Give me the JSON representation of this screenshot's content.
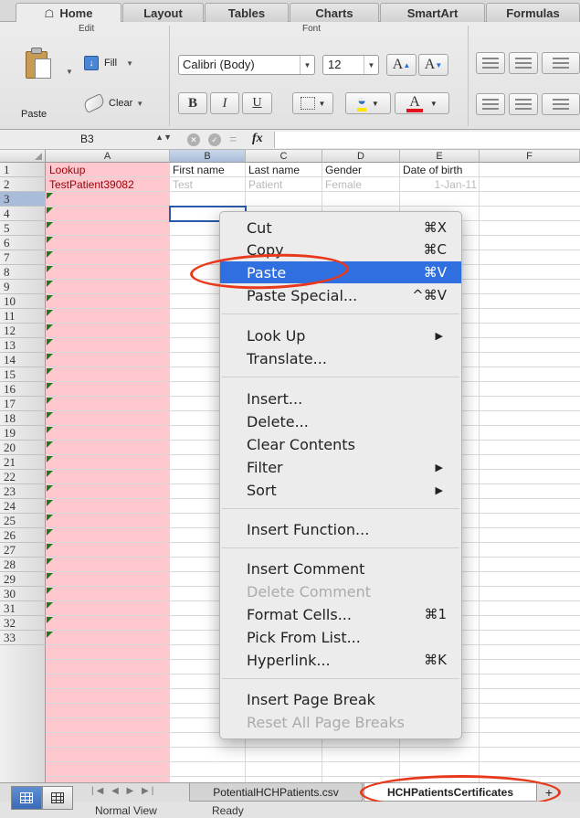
{
  "ribbon_tabs": [
    "Home",
    "Layout",
    "Tables",
    "Charts",
    "SmartArt",
    "Formulas"
  ],
  "ribbon": {
    "edit_group": "Edit",
    "font_group": "Font",
    "paste_label": "Paste",
    "fill_label": "Fill",
    "clear_label": "Clear",
    "font_name": "Calibri (Body)",
    "font_size": "12",
    "grow_font": "A",
    "shrink_font": "A",
    "bold": "B",
    "italic": "I",
    "underline": "U",
    "font_color": "A"
  },
  "formula_bar": {
    "name_box": "B3",
    "fx": "fx"
  },
  "columns": [
    "A",
    "B",
    "C",
    "D",
    "E",
    "F"
  ],
  "rows": [
    "1",
    "2",
    "3",
    "4",
    "5",
    "6",
    "7",
    "8",
    "9",
    "10",
    "11",
    "12",
    "13",
    "14",
    "15",
    "16",
    "17",
    "18",
    "19",
    "20",
    "21",
    "22",
    "23",
    "24",
    "25",
    "26",
    "27",
    "28",
    "29",
    "30",
    "31",
    "32",
    "33"
  ],
  "cells": {
    "A1": "Lookup",
    "A2": "TestPatient39082",
    "B1": "First name",
    "C1": "Last name",
    "D1": "Gender",
    "E1": "Date of birth",
    "B2": "Test",
    "C2": "Patient",
    "D2": "Female",
    "E2": "1-Jan-11"
  },
  "context_menu": {
    "cut": "Cut",
    "cut_sc": "⌘X",
    "copy": "Copy",
    "copy_sc": "⌘C",
    "paste": "Paste",
    "paste_sc": "⌘V",
    "paste_special": "Paste Special...",
    "paste_special_sc": "^⌘V",
    "look_up": "Look Up",
    "translate": "Translate...",
    "insert": "Insert...",
    "delete": "Delete...",
    "clear_contents": "Clear Contents",
    "filter": "Filter",
    "sort": "Sort",
    "insert_function": "Insert Function...",
    "insert_comment": "Insert Comment",
    "delete_comment": "Delete Comment",
    "format_cells": "Format Cells...",
    "format_cells_sc": "⌘1",
    "pick_from_list": "Pick From List...",
    "hyperlink": "Hyperlink...",
    "hyperlink_sc": "⌘K",
    "insert_page_break": "Insert Page Break",
    "reset_page_breaks": "Reset All Page Breaks"
  },
  "sheets": [
    "PotentialHCHPatients.csv",
    "HCHPatientsCertificates"
  ],
  "status": {
    "view": "Normal View",
    "state": "Ready"
  },
  "colors": {
    "accent": "#2f6fe0",
    "pink_fill": "#ffc7ce",
    "red_text": "#9c0006",
    "annotation": "#e8391d"
  }
}
